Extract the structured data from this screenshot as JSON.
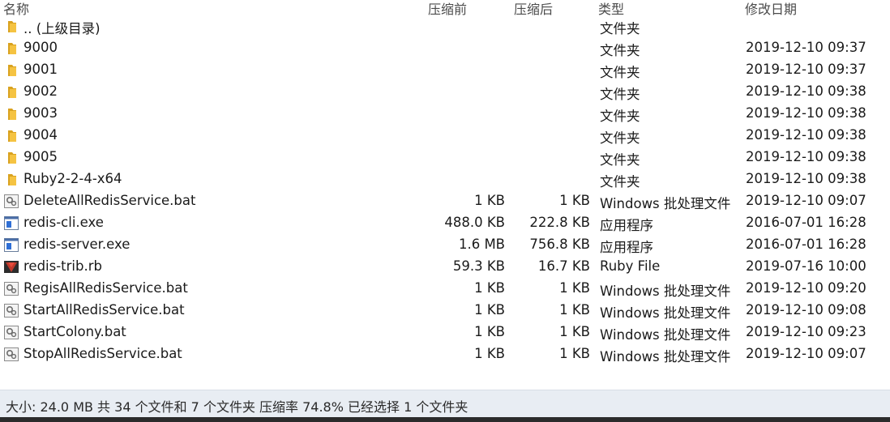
{
  "columns": {
    "name": "名称",
    "compressed": "压缩前",
    "original": "压缩后",
    "type": "类型",
    "modified": "修改日期"
  },
  "rows": [
    {
      "name": ".. (上级目录)",
      "csize": "",
      "osize": "",
      "type": "文件夹",
      "date": "",
      "icon": "folder-up-icon"
    },
    {
      "name": "9000",
      "csize": "",
      "osize": "",
      "type": "文件夹",
      "date": "2019-12-10 09:37",
      "icon": "folder-icon"
    },
    {
      "name": "9001",
      "csize": "",
      "osize": "",
      "type": "文件夹",
      "date": "2019-12-10 09:37",
      "icon": "folder-icon"
    },
    {
      "name": "9002",
      "csize": "",
      "osize": "",
      "type": "文件夹",
      "date": "2019-12-10 09:38",
      "icon": "folder-icon"
    },
    {
      "name": "9003",
      "csize": "",
      "osize": "",
      "type": "文件夹",
      "date": "2019-12-10 09:38",
      "icon": "folder-icon"
    },
    {
      "name": "9004",
      "csize": "",
      "osize": "",
      "type": "文件夹",
      "date": "2019-12-10 09:38",
      "icon": "folder-icon"
    },
    {
      "name": "9005",
      "csize": "",
      "osize": "",
      "type": "文件夹",
      "date": "2019-12-10 09:38",
      "icon": "folder-icon"
    },
    {
      "name": "Ruby2-2-4-x64",
      "csize": "",
      "osize": "",
      "type": "文件夹",
      "date": "2019-12-10 09:38",
      "icon": "folder-icon"
    },
    {
      "name": "DeleteAllRedisService.bat",
      "csize": "1 KB",
      "osize": "1 KB",
      "type": "Windows 批处理文件",
      "date": "2019-12-10 09:07",
      "icon": "batch-file-icon"
    },
    {
      "name": "redis-cli.exe",
      "csize": "488.0 KB",
      "osize": "222.8 KB",
      "type": "应用程序",
      "date": "2016-07-01 16:28",
      "icon": "exe-file-icon"
    },
    {
      "name": "redis-server.exe",
      "csize": "1.6 MB",
      "osize": "756.8 KB",
      "type": "应用程序",
      "date": "2016-07-01 16:28",
      "icon": "exe-file-icon"
    },
    {
      "name": "redis-trib.rb",
      "csize": "59.3 KB",
      "osize": "16.7 KB",
      "type": "Ruby File",
      "date": "2019-07-16 10:00",
      "icon": "ruby-file-icon"
    },
    {
      "name": "RegisAllRedisService.bat",
      "csize": "1 KB",
      "osize": "1 KB",
      "type": "Windows 批处理文件",
      "date": "2019-12-10 09:20",
      "icon": "batch-file-icon"
    },
    {
      "name": "StartAllRedisService.bat",
      "csize": "1 KB",
      "osize": "1 KB",
      "type": "Windows 批处理文件",
      "date": "2019-12-10 09:08",
      "icon": "batch-file-icon"
    },
    {
      "name": "StartColony.bat",
      "csize": "1 KB",
      "osize": "1 KB",
      "type": "Windows 批处理文件",
      "date": "2019-12-10 09:23",
      "icon": "batch-file-icon"
    },
    {
      "name": "StopAllRedisService.bat",
      "csize": "1 KB",
      "osize": "1 KB",
      "type": "Windows 批处理文件",
      "date": "2019-12-10 09:07",
      "icon": "batch-file-icon"
    }
  ],
  "status": "大小: 24.0 MB 共 34 个文件和 7 个文件夹 压缩率 74.8% 已经选择 1 个文件夹",
  "colors": {
    "folder": "#f5c342",
    "folder_dark": "#d9a21f",
    "status_bg": "#e8edf3",
    "exe_blue": "#2f6fd6"
  }
}
